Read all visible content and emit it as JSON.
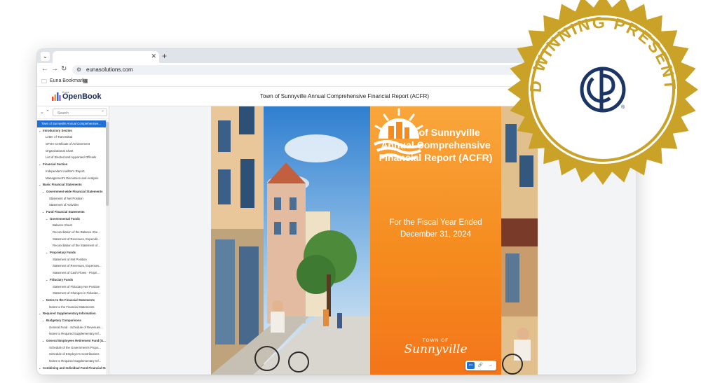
{
  "browser": {
    "url": "eunasolutions.com",
    "bookmarks_label": "Euna Bookmarks"
  },
  "app": {
    "logo_small": "Euna",
    "logo_text": "OpenBook",
    "document_title": "Town of Sunnyville Annual Comprehensive Financial Report (ACFR)"
  },
  "sidebar": {
    "search_placeholder": "Search",
    "toc": [
      {
        "label": "Town of Sunnyville Annual Comprehensive...",
        "level": 0,
        "bold": false,
        "selected": true,
        "caret": false
      },
      {
        "label": "Introductory Section",
        "level": 0,
        "bold": true,
        "selected": false,
        "caret": true
      },
      {
        "label": "Letter of Transmittal",
        "level": 2,
        "bold": false,
        "selected": false,
        "caret": false
      },
      {
        "label": "GFOA Certificate of Achievement",
        "level": 2,
        "bold": false,
        "selected": false,
        "caret": false
      },
      {
        "label": "Organizational Chart",
        "level": 2,
        "bold": false,
        "selected": false,
        "caret": false
      },
      {
        "label": "List of Elected and Appointed Officials",
        "level": 2,
        "bold": false,
        "selected": false,
        "caret": false
      },
      {
        "label": "Financial Section",
        "level": 0,
        "bold": true,
        "selected": false,
        "caret": true
      },
      {
        "label": "Independent Auditor's Report",
        "level": 2,
        "bold": false,
        "selected": false,
        "caret": false
      },
      {
        "label": "Management's Discussion and Analysis",
        "level": 2,
        "bold": false,
        "selected": false,
        "caret": false
      },
      {
        "label": "Basic Financial Statements",
        "level": 0,
        "bold": true,
        "selected": false,
        "caret": true
      },
      {
        "label": "Government-wide Financial Statements",
        "level": 1,
        "bold": true,
        "selected": false,
        "caret": true
      },
      {
        "label": "Statement of Net Position",
        "level": 3,
        "bold": false,
        "selected": false,
        "caret": false
      },
      {
        "label": "Statement of Activities",
        "level": 3,
        "bold": false,
        "selected": false,
        "caret": false
      },
      {
        "label": "Fund Financial Statements",
        "level": 1,
        "bold": true,
        "selected": false,
        "caret": true
      },
      {
        "label": "Governmental Funds",
        "level": 2,
        "bold": true,
        "selected": false,
        "caret": true
      },
      {
        "label": "Balance Sheet",
        "level": 4,
        "bold": false,
        "selected": false,
        "caret": false
      },
      {
        "label": "Reconciliation of the Balance She...",
        "level": 4,
        "bold": false,
        "selected": false,
        "caret": false
      },
      {
        "label": "Statement of Revenues, Expendit...",
        "level": 4,
        "bold": false,
        "selected": false,
        "caret": false
      },
      {
        "label": "Reconciliation of the Statement of...",
        "level": 4,
        "bold": false,
        "selected": false,
        "caret": false
      },
      {
        "label": "Proprietary Funds",
        "level": 2,
        "bold": true,
        "selected": false,
        "caret": true
      },
      {
        "label": "Statement of Net Position",
        "level": 4,
        "bold": false,
        "selected": false,
        "caret": false
      },
      {
        "label": "Statement of Revenues, Expenses...",
        "level": 4,
        "bold": false,
        "selected": false,
        "caret": false
      },
      {
        "label": "Statement of Cash Flows - Propri...",
        "level": 4,
        "bold": false,
        "selected": false,
        "caret": false
      },
      {
        "label": "Fiduciary Funds",
        "level": 2,
        "bold": true,
        "selected": false,
        "caret": true
      },
      {
        "label": "Statement of Fiduciary Net Position",
        "level": 4,
        "bold": false,
        "selected": false,
        "caret": false
      },
      {
        "label": "Statement of Changes in Fiducian...",
        "level": 4,
        "bold": false,
        "selected": false,
        "caret": false
      },
      {
        "label": "Notes to the Financial Statements",
        "level": 1,
        "bold": true,
        "selected": false,
        "caret": true
      },
      {
        "label": "Notes to the Financial Statements",
        "level": 3,
        "bold": false,
        "selected": false,
        "caret": false
      },
      {
        "label": "Required Supplementary Information",
        "level": 0,
        "bold": true,
        "selected": false,
        "caret": true
      },
      {
        "label": "Budgetary Comparisons",
        "level": 1,
        "bold": true,
        "selected": false,
        "caret": true
      },
      {
        "label": "General Fund - Schedule of Revenues...",
        "level": 3,
        "bold": false,
        "selected": false,
        "caret": false
      },
      {
        "label": "Notes to Required Supplementary Inf...",
        "level": 3,
        "bold": false,
        "selected": false,
        "caret": false
      },
      {
        "label": "General Employees Retirement Fund (G...",
        "level": 1,
        "bold": true,
        "selected": false,
        "caret": true
      },
      {
        "label": "Schedule of the Government's Propo...",
        "level": 3,
        "bold": false,
        "selected": false,
        "caret": false
      },
      {
        "label": "Schedule of Employer's Contributions",
        "level": 3,
        "bold": false,
        "selected": false,
        "caret": false
      },
      {
        "label": "Notes to Required Supplementary Inf...",
        "level": 3,
        "bold": false,
        "selected": false,
        "caret": false
      },
      {
        "label": "Combining and Individual Fund Financial St...",
        "level": 0,
        "bold": true,
        "selected": false,
        "caret": true
      }
    ]
  },
  "cover": {
    "title": "Town of Sunnyville Annual Comprehensive Financial Report (ACFR)",
    "subtitle": "For the Fiscal Year Ended December 31, 2024",
    "town_of": "TOWN OF",
    "town_name": "Sunnyville"
  },
  "seal": {
    "text": "AWARD WINNING PRESENTATION",
    "logo_letters": "GFOA",
    "registered": "®"
  },
  "colors": {
    "accent_blue": "#1f6fd6",
    "cover_orange": "#f58b1f",
    "seal_gold": "#c9a227",
    "seal_navy": "#1b3566"
  },
  "icons": {
    "tab_dropdown": "chevron-down-icon",
    "tab_close": "close-icon",
    "new_tab": "plus-icon",
    "back": "arrow-left-icon",
    "forward": "arrow-right-icon",
    "reload": "reload-icon",
    "site_info": "tune-icon",
    "bookmark_folder": "folder-icon",
    "apps": "grid-icon"
  }
}
